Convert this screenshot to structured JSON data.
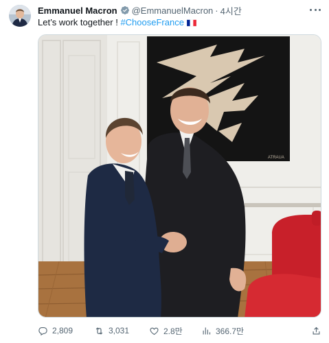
{
  "tweet": {
    "author_name": "Emmanuel Macron",
    "handle": "@EmmanuelMacron",
    "separator": "·",
    "time": "4시간",
    "text_prefix": "Let’s work together ! ",
    "hashtag": "#ChooseFrance",
    "flag_icon": "flag-france-icon",
    "more_icon": "more-dots-icon"
  },
  "media": {
    "type": "photo",
    "artwork_signature": "ATRAUA"
  },
  "actions": {
    "replies": "2,809",
    "reposts": "3,031",
    "likes": "2.8만",
    "views": "366.7만",
    "icons": [
      "reply-icon",
      "repost-icon",
      "like-icon",
      "views-icon",
      "share-icon"
    ]
  },
  "colors": {
    "link": "#1d9bf0",
    "secondary_text": "#536471",
    "verified_badge": "#829aab"
  }
}
